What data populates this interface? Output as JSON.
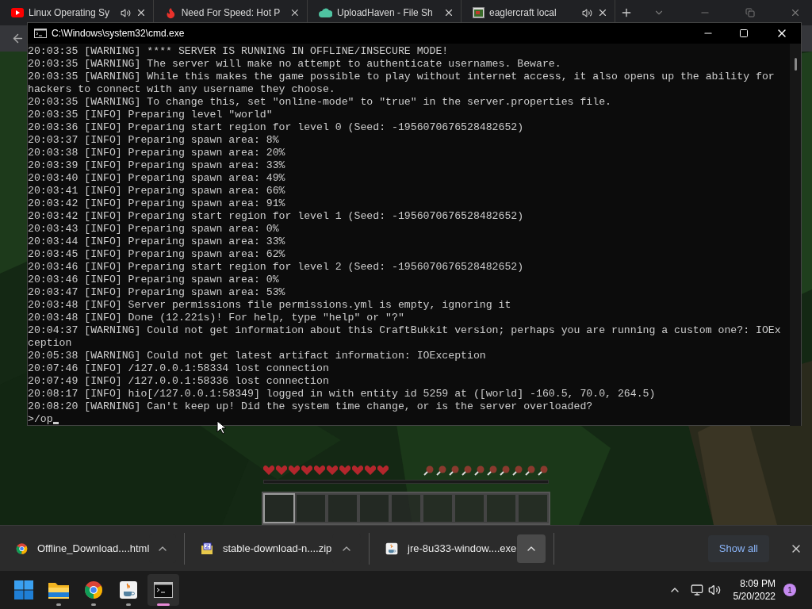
{
  "browser": {
    "tabs": [
      {
        "title": "Linux Operating Sy",
        "kind": "youtube",
        "audio": true
      },
      {
        "title": "Need For Speed: Hot P",
        "kind": "flame",
        "audio": false
      },
      {
        "title": "UploadHaven - File Sh",
        "kind": "cloud",
        "audio": false
      },
      {
        "title": "eaglercraft local",
        "kind": "window",
        "audio": true
      }
    ]
  },
  "console": {
    "title": "C:\\Windows\\system32\\cmd.exe",
    "lines": [
      "20:03:35 [WARNING] **** SERVER IS RUNNING IN OFFLINE/INSECURE MODE!",
      "20:03:35 [WARNING] The server will make no attempt to authenticate usernames. Beware.",
      "20:03:35 [WARNING] While this makes the game possible to play without internet access, it also opens up the ability for",
      "hackers to connect with any username they choose.",
      "20:03:35 [WARNING] To change this, set \"online-mode\" to \"true\" in the server.properties file.",
      "20:03:35 [INFO] Preparing level \"world\"",
      "20:03:36 [INFO] Preparing start region for level 0 (Seed: -1956070676528482652)",
      "20:03:37 [INFO] Preparing spawn area: 8%",
      "20:03:38 [INFO] Preparing spawn area: 20%",
      "20:03:39 [INFO] Preparing spawn area: 33%",
      "20:03:40 [INFO] Preparing spawn area: 49%",
      "20:03:41 [INFO] Preparing spawn area: 66%",
      "20:03:42 [INFO] Preparing spawn area: 91%",
      "20:03:42 [INFO] Preparing start region for level 1 (Seed: -1956070676528482652)",
      "20:03:43 [INFO] Preparing spawn area: 0%",
      "20:03:44 [INFO] Preparing spawn area: 33%",
      "20:03:45 [INFO] Preparing spawn area: 62%",
      "20:03:46 [INFO] Preparing start region for level 2 (Seed: -1956070676528482652)",
      "20:03:46 [INFO] Preparing spawn area: 0%",
      "20:03:47 [INFO] Preparing spawn area: 53%",
      "20:03:48 [INFO] Server permissions file permissions.yml is empty, ignoring it",
      "20:03:48 [INFO] Done (12.221s)! For help, type \"help\" or \"?\"",
      "20:04:37 [WARNING] Could not get information about this CraftBukkit version; perhaps you are running a custom one?: IOEx",
      "ception",
      "20:05:38 [WARNING] Could not get latest artifact information: IOException",
      "20:07:46 [INFO] /127.0.0.1:58334 lost connection",
      "20:07:49 [INFO] /127.0.0.1:58336 lost connection",
      "20:08:17 [INFO] hio[/127.0.0.1:58349] logged in with entity id 5259 at ([world] -160.5, 70.0, 264.5)",
      "20:08:20 [WARNING] Can't keep up! Did the system time change, or is the server overloaded?"
    ],
    "input": ">/op"
  },
  "downloads": {
    "items": [
      {
        "name": "Offline_Download....html",
        "kind": "chrome",
        "highlighted": false
      },
      {
        "name": "stable-download-n....zip",
        "kind": "archive",
        "highlighted": false
      },
      {
        "name": "jre-8u333-window....exe",
        "kind": "java",
        "highlighted": true
      }
    ],
    "show_all": "Show all"
  },
  "taskbar": {
    "apps": [
      {
        "kind": "start",
        "running": false,
        "active": false
      },
      {
        "kind": "folder",
        "running": true,
        "active": false
      },
      {
        "kind": "chrome",
        "running": true,
        "active": false
      },
      {
        "kind": "java",
        "running": true,
        "active": false
      },
      {
        "kind": "terminal",
        "running": true,
        "active": true
      }
    ],
    "time": "8:09 PM",
    "date": "5/20/2022",
    "notifications": "1"
  }
}
